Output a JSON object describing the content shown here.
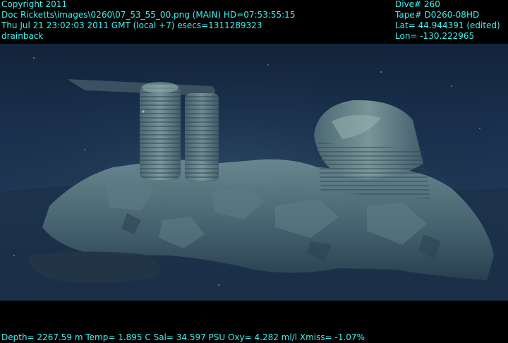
{
  "header_left": {
    "line1": "Copyright 2011",
    "line2": "Doc Ricketts\\images\\0260\\07_53_55_00.png (MAIN)  HD=07:53:55:15",
    "line3": "Thu Jul 21 23:02:03 2011 GMT (local +7)  esecs=1311289323",
    "line4": "drainback"
  },
  "header_right": {
    "line1": "Dive# 260",
    "line2": "Tape# D0260-08HD",
    "line3": "Lat= 44.944391 (edited)",
    "line4": "Lon= -130.222965"
  },
  "footer": {
    "line1": "Depth= 2267.59 m  Temp= 1.895 C  Sal= 34.597 PSU  Oxy= 4.282 ml/l  Xmiss= -1.07%"
  },
  "colors": {
    "overlay_text": "#3ff0f0",
    "frame": "#000000",
    "water": "#1a3150",
    "rock": "#5b7a86"
  }
}
